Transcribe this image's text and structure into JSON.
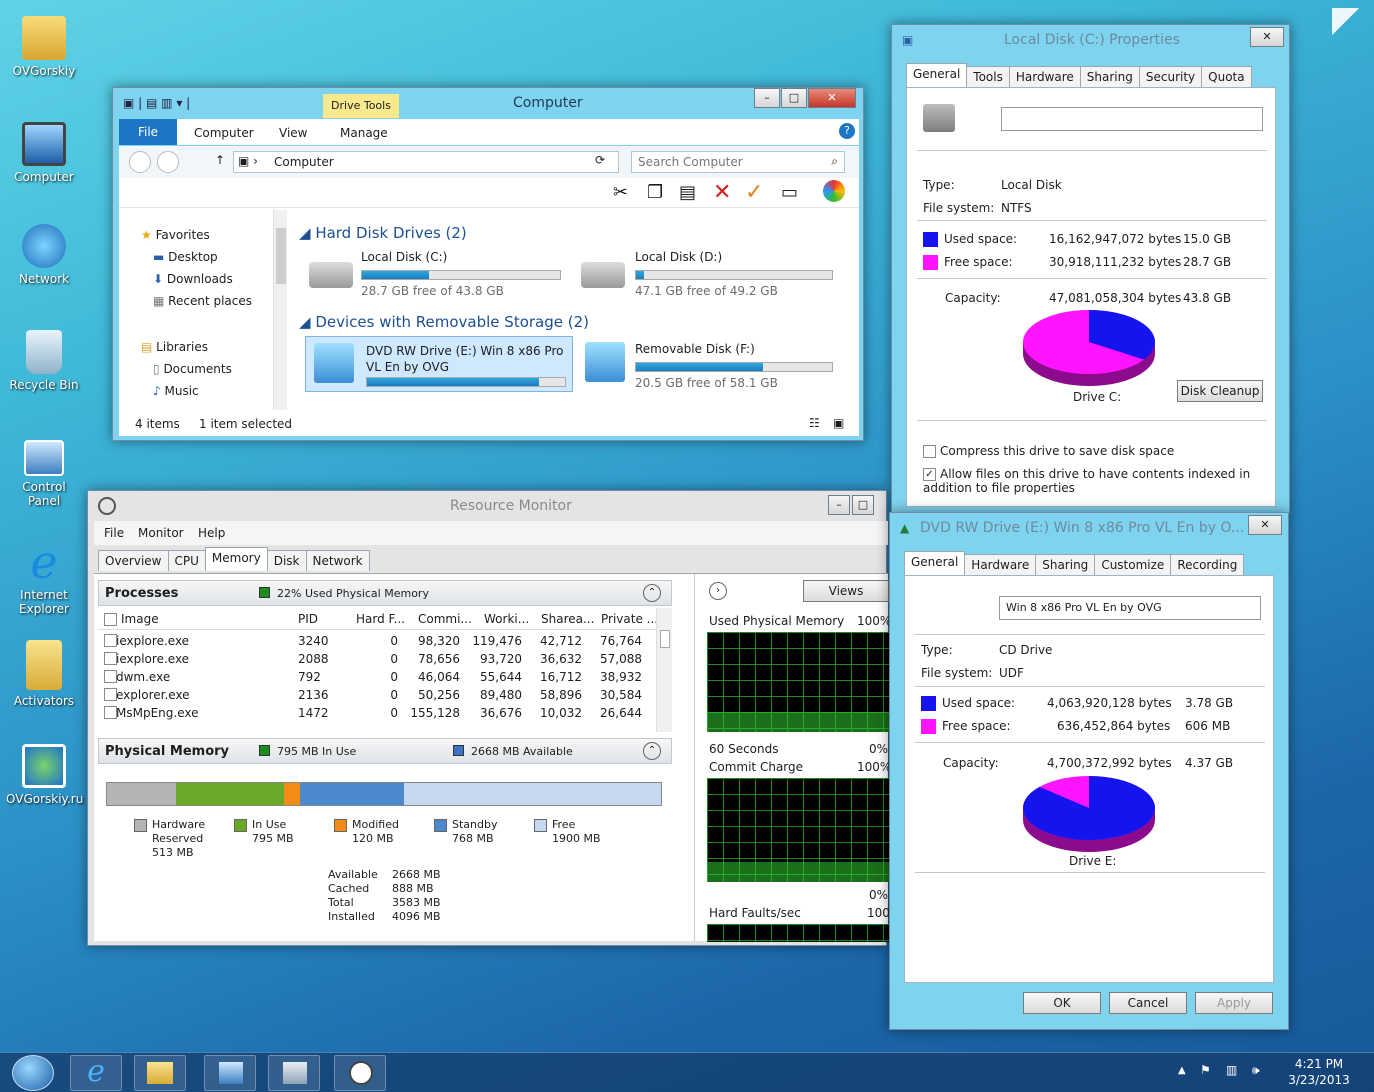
{
  "desktop": {
    "icons": [
      {
        "label": "OVGorskiy",
        "icon": "user-folder-icon"
      },
      {
        "label": "Computer",
        "icon": "computer-icon"
      },
      {
        "label": "Network",
        "icon": "network-icon"
      },
      {
        "label": "Recycle Bin",
        "icon": "recycle-bin-icon"
      },
      {
        "label": "Control Panel",
        "icon": "control-panel-icon"
      },
      {
        "label": "Internet Explorer",
        "icon": "internet-explorer-icon"
      },
      {
        "label": "Activators",
        "icon": "folder-icon"
      },
      {
        "label": "OVGorskiy.ru",
        "icon": "globe-shortcut-icon"
      }
    ]
  },
  "explorer": {
    "title": "Computer",
    "context_tab": "Drive Tools",
    "ribbon_tabs": [
      "File",
      "Computer",
      "View",
      "Manage"
    ],
    "address": "Computer",
    "search_placeholder": "Search Computer",
    "nav": {
      "favorites": "Favorites",
      "favorites_items": [
        "Desktop",
        "Downloads",
        "Recent places"
      ],
      "libraries": "Libraries",
      "libraries_items": [
        "Documents",
        "Music"
      ]
    },
    "groups": {
      "hdd": "Hard Disk Drives (2)",
      "removable": "Devices with Removable Storage (2)"
    },
    "drives": [
      {
        "name": "Local Disk (C:)",
        "info": "28.7 GB free of 43.8 GB",
        "used_fraction": 0.34
      },
      {
        "name": "Local Disk (D:)",
        "info": "47.1 GB free of 49.2 GB",
        "used_fraction": 0.04
      },
      {
        "name": "DVD RW Drive (E:) Win 8 x86 Pro VL En by OVG",
        "info": "",
        "used_fraction": 0.87
      },
      {
        "name": "Removable Disk (F:)",
        "info": "20.5 GB free of 58.1 GB",
        "used_fraction": 0.65
      }
    ],
    "status": {
      "items": "4 items",
      "selected": "1 item selected"
    }
  },
  "resmon": {
    "title": "Resource Monitor",
    "menu": [
      "File",
      "Monitor",
      "Help"
    ],
    "tabs": [
      "Overview",
      "CPU",
      "Memory",
      "Disk",
      "Network"
    ],
    "processes": {
      "header": "Processes",
      "summary": "22% Used Physical Memory",
      "columns": [
        "Image",
        "PID",
        "Hard F...",
        "Commi...",
        "Worki...",
        "Sharea...",
        "Private ..."
      ],
      "rows": [
        [
          "iexplore.exe",
          "3240",
          "0",
          "98,320",
          "119,476",
          "42,712",
          "76,764"
        ],
        [
          "iexplore.exe",
          "2088",
          "0",
          "78,656",
          "93,720",
          "36,632",
          "57,088"
        ],
        [
          "dwm.exe",
          "792",
          "0",
          "46,064",
          "55,644",
          "16,712",
          "38,932"
        ],
        [
          "explorer.exe",
          "2136",
          "0",
          "50,256",
          "89,480",
          "58,896",
          "30,584"
        ],
        [
          "MsMpEng.exe",
          "1472",
          "0",
          "155,128",
          "36,676",
          "10,032",
          "26,644"
        ]
      ]
    },
    "physical": {
      "header": "Physical Memory",
      "in_use": "795 MB In Use",
      "available": "2668 MB Available",
      "segments": [
        {
          "label": "Hardware Reserved",
          "value": "513 MB",
          "color": "#b4b4b4",
          "mb": 513
        },
        {
          "label": "In Use",
          "value": "795 MB",
          "color": "#6aa82a",
          "mb": 795
        },
        {
          "label": "Modified",
          "value": "120 MB",
          "color": "#f28c17",
          "mb": 120
        },
        {
          "label": "Standby",
          "value": "768 MB",
          "color": "#4c88cc",
          "mb": 768
        },
        {
          "label": "Free",
          "value": "1900 MB",
          "color": "#c6d8ef",
          "mb": 1900
        }
      ],
      "totals": [
        {
          "label": "Available",
          "value": "2668 MB"
        },
        {
          "label": "Cached",
          "value": "888 MB"
        },
        {
          "label": "Total",
          "value": "3583 MB"
        },
        {
          "label": "Installed",
          "value": "4096 MB"
        }
      ]
    },
    "graphs": {
      "views": "Views",
      "used_physical": "Used Physical Memory",
      "used_pct": "100%",
      "seconds": "60 Seconds",
      "zero": "0%",
      "commit": "Commit Charge",
      "commit_pct": "100%",
      "zero2": "0%",
      "faults": "Hard Faults/sec",
      "faults_max": "100"
    }
  },
  "propsC": {
    "title": "Local Disk (C:) Properties",
    "tabs": [
      "General",
      "Tools",
      "Hardware",
      "Sharing",
      "Security",
      "Quota"
    ],
    "type_label": "Type:",
    "type": "Local Disk",
    "fs_label": "File system:",
    "fs": "NTFS",
    "used_label": "Used space:",
    "used_bytes": "16,162,947,072 bytes",
    "used_gb": "15.0 GB",
    "free_label": "Free space:",
    "free_bytes": "30,918,111,232 bytes",
    "free_gb": "28.7 GB",
    "cap_label": "Capacity:",
    "cap_bytes": "47,081,058,304 bytes",
    "cap_gb": "43.8 GB",
    "drive": "Drive C:",
    "cleanup": "Disk Cleanup",
    "compress": "Compress this drive to save disk space",
    "index": "Allow files on this drive to have contents indexed in addition to file properties",
    "used_fraction": 0.343,
    "used_color": "#1414ee",
    "free_color": "#ff14ff"
  },
  "propsE": {
    "title": "DVD RW Drive (E:) Win 8 x86 Pro VL En by O...",
    "tabs": [
      "General",
      "Hardware",
      "Sharing",
      "Customize",
      "Recording"
    ],
    "label": "Win 8 x86 Pro VL En by OVG",
    "type_label": "Type:",
    "type": "CD Drive",
    "fs_label": "File system:",
    "fs": "UDF",
    "used_label": "Used space:",
    "used_bytes": "4,063,920,128 bytes",
    "used_gb": "3.78 GB",
    "free_label": "Free space:",
    "free_bytes": "636,452,864 bytes",
    "free_gb": "606 MB",
    "cap_label": "Capacity:",
    "cap_bytes": "4,700,372,992 bytes",
    "cap_gb": "4.37 GB",
    "drive": "Drive E:",
    "ok": "OK",
    "cancel": "Cancel",
    "apply": "Apply",
    "used_fraction": 0.865
  },
  "taskbar": {
    "time": "4:21 PM",
    "date": "3/23/2013",
    "items": [
      "start-button-icon",
      "internet-explorer-icon",
      "file-explorer-icon",
      "control-panel-icon",
      "system-info-icon",
      "resource-monitor-icon"
    ]
  }
}
